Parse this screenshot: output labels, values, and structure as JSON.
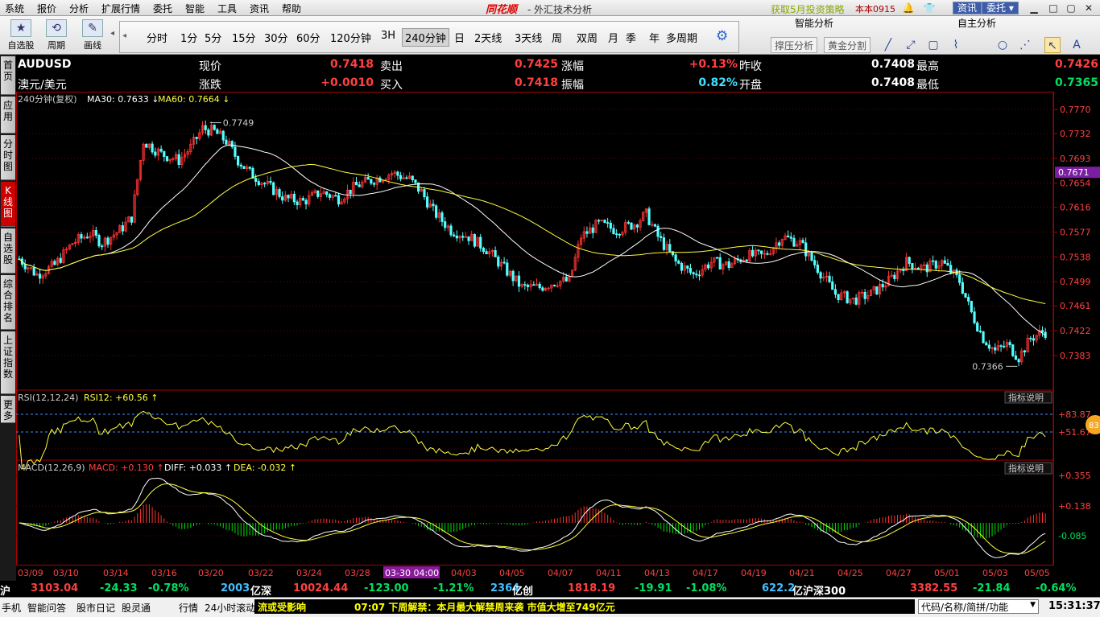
{
  "menubar": {
    "items": [
      "系统",
      "报价",
      "分析",
      "扩展行情",
      "委托",
      "智能",
      "工具",
      "资讯",
      "帮助"
    ],
    "brand": "同花顺",
    "title": "- 外汇技术分析",
    "promo": "获取5月投资策略",
    "version": "本本0915",
    "btn_news": "资讯",
    "btn_trade": "委托"
  },
  "toolbar": {
    "tools": [
      {
        "label": "自选股",
        "icon": "star-icon"
      },
      {
        "label": "周期",
        "icon": "cycle-icon"
      },
      {
        "label": "画线",
        "icon": "pencil-icon"
      }
    ],
    "periods": [
      "分时",
      "1分",
      "5分",
      "15分",
      "30分",
      "60分",
      "120分钟",
      "3H",
      "240分钟",
      "日",
      "2天线",
      "3天线",
      "周",
      "双周",
      "月",
      "季",
      "年",
      "多周期"
    ],
    "active_period": "240分钟"
  },
  "right_panel": {
    "smart_title": "智能分析",
    "self_title": "自主分析",
    "btn_support": "撑压分析",
    "btn_golden": "黄金分割"
  },
  "sidetabs": [
    "首页",
    "应用",
    "分时图",
    "K线图",
    "自选股",
    "综合排名",
    "上证指数",
    "更多"
  ],
  "quote": {
    "symbol": "AUDUSD",
    "name": "澳元/美元",
    "row1": [
      {
        "label": "现价",
        "value": "0.7418",
        "cls": "red"
      },
      {
        "label": "卖出",
        "value": "0.7425",
        "cls": "red"
      },
      {
        "label": "涨幅",
        "value": "+0.13%",
        "cls": "red"
      },
      {
        "label": "昨收",
        "value": "0.7408",
        "cls": "white"
      },
      {
        "label": "最高",
        "value": "0.7426",
        "cls": "red"
      }
    ],
    "row2": [
      {
        "label": "涨跌",
        "value": "+0.0010",
        "cls": "red"
      },
      {
        "label": "买入",
        "value": "0.7418",
        "cls": "red"
      },
      {
        "label": "振幅",
        "value": "0.82%",
        "cls": "cyan"
      },
      {
        "label": "开盘",
        "value": "0.7408",
        "cls": "white"
      },
      {
        "label": "最低",
        "value": "0.7365",
        "cls": "green"
      }
    ]
  },
  "chart_data": {
    "type": "candlestick",
    "period_label": "240分钟(复权)",
    "ma30_label": "MA30: 0.7633",
    "ma60_label": "MA60: 0.7664",
    "price_ticks": [
      "0.7770",
      "0.7732",
      "0.7693",
      "0.7654",
      "0.7616",
      "0.7577",
      "0.7538",
      "0.7499",
      "0.7461",
      "0.7422",
      "0.7383"
    ],
    "current_price_tag": "0.7671",
    "ylim": [
      0.735,
      0.7775
    ],
    "high_label": "0.7749",
    "low_label": "0.7366",
    "dates": [
      "03/09",
      "03/10",
      "03/14",
      "03/16",
      "03/20",
      "03/22",
      "03/24",
      "03/28",
      "03-30 04:00",
      "04/03",
      "04/05",
      "04/07",
      "04/11",
      "04/13",
      "04/17",
      "04/19",
      "04/21",
      "04/25",
      "04/27",
      "05/01",
      "05/03",
      "05/05"
    ],
    "price_path": [
      [
        0,
        0.7535
      ],
      [
        6,
        0.751
      ],
      [
        12,
        0.7525
      ],
      [
        18,
        0.756
      ],
      [
        24,
        0.7575
      ],
      [
        28,
        0.756
      ],
      [
        34,
        0.758
      ],
      [
        38,
        0.76
      ],
      [
        42,
        0.772
      ],
      [
        48,
        0.77
      ],
      [
        54,
        0.769
      ],
      [
        58,
        0.771
      ],
      [
        62,
        0.774
      ],
      [
        66,
        0.7735
      ],
      [
        70,
        0.772
      ],
      [
        74,
        0.769
      ],
      [
        78,
        0.767
      ],
      [
        84,
        0.765
      ],
      [
        90,
        0.763
      ],
      [
        96,
        0.7625
      ],
      [
        102,
        0.764
      ],
      [
        108,
        0.763
      ],
      [
        114,
        0.765
      ],
      [
        120,
        0.766
      ],
      [
        126,
        0.767
      ],
      [
        132,
        0.766
      ],
      [
        136,
        0.764
      ],
      [
        140,
        0.761
      ],
      [
        146,
        0.758
      ],
      [
        152,
        0.757
      ],
      [
        158,
        0.755
      ],
      [
        164,
        0.752
      ],
      [
        170,
        0.749
      ],
      [
        176,
        0.749
      ],
      [
        182,
        0.75
      ],
      [
        186,
        0.75
      ],
      [
        190,
        0.757
      ],
      [
        196,
        0.759
      ],
      [
        202,
        0.758
      ],
      [
        208,
        0.759
      ],
      [
        212,
        0.7605
      ],
      [
        216,
        0.757
      ],
      [
        222,
        0.753
      ],
      [
        228,
        0.751
      ],
      [
        234,
        0.753
      ],
      [
        240,
        0.7525
      ],
      [
        246,
        0.754
      ],
      [
        252,
        0.754
      ],
      [
        258,
        0.757
      ],
      [
        264,
        0.756
      ],
      [
        270,
        0.752
      ],
      [
        276,
        0.748
      ],
      [
        282,
        0.747
      ],
      [
        288,
        0.748
      ],
      [
        294,
        0.75
      ],
      [
        300,
        0.753
      ],
      [
        306,
        0.752
      ],
      [
        312,
        0.753
      ],
      [
        318,
        0.75
      ],
      [
        322,
        0.745
      ],
      [
        326,
        0.741
      ],
      [
        330,
        0.739
      ],
      [
        334,
        0.74
      ],
      [
        338,
        0.738
      ],
      [
        342,
        0.741
      ],
      [
        346,
        0.742
      ]
    ],
    "rsi_label": "RSI(12,12,24)",
    "rsi12_label": "RSI12: +60.56",
    "rsi_ticks": [
      "+83.87",
      "+51.67"
    ],
    "rsi_badge": "83",
    "macd_label": "MACD(12,26,9)",
    "macd_value_label": "MACD: +0.130",
    "diff_label": "DIFF: +0.033",
    "dea_label": "DEA: -0.032",
    "macd_ticks": [
      "+0.355",
      "+0.138",
      "-0.085"
    ],
    "indicator_btn": "指标说明"
  },
  "status1": [
    {
      "t": "沪",
      "c": "white"
    },
    {
      "t": "3103.04",
      "c": "red"
    },
    {
      "t": "-24.33",
      "c": "green"
    },
    {
      "t": "-0.78%",
      "c": "green"
    },
    {
      "t": "2003",
      "c": "cyan"
    },
    {
      "t": "亿深",
      "c": "white"
    },
    {
      "t": "10024.44",
      "c": "red"
    },
    {
      "t": "-123.00",
      "c": "green"
    },
    {
      "t": "-1.21%",
      "c": "green"
    },
    {
      "t": "2364",
      "c": "cyan"
    },
    {
      "t": "亿创",
      "c": "white"
    },
    {
      "t": "1818.19",
      "c": "red"
    },
    {
      "t": "-19.91",
      "c": "green"
    },
    {
      "t": "-1.08%",
      "c": "green"
    },
    {
      "t": "622.2",
      "c": "cyan"
    },
    {
      "t": "亿沪深300",
      "c": "white"
    },
    {
      "t": "3382.55",
      "c": "red"
    },
    {
      "t": "-21.84",
      "c": "green"
    },
    {
      "t": "-0.64%",
      "c": "green"
    }
  ],
  "status2": {
    "items": [
      "手机",
      "智能问答",
      "股市日记",
      "股灵通",
      "行情",
      "24小时滚动"
    ],
    "ticker_prefix": "流或受影响",
    "ticker": "07:07 下周解禁：本月最大解禁周来袭 市值大增至749亿元",
    "search_placeholder": "代码/名称/简拼/功能",
    "clock": "15:31:37"
  }
}
